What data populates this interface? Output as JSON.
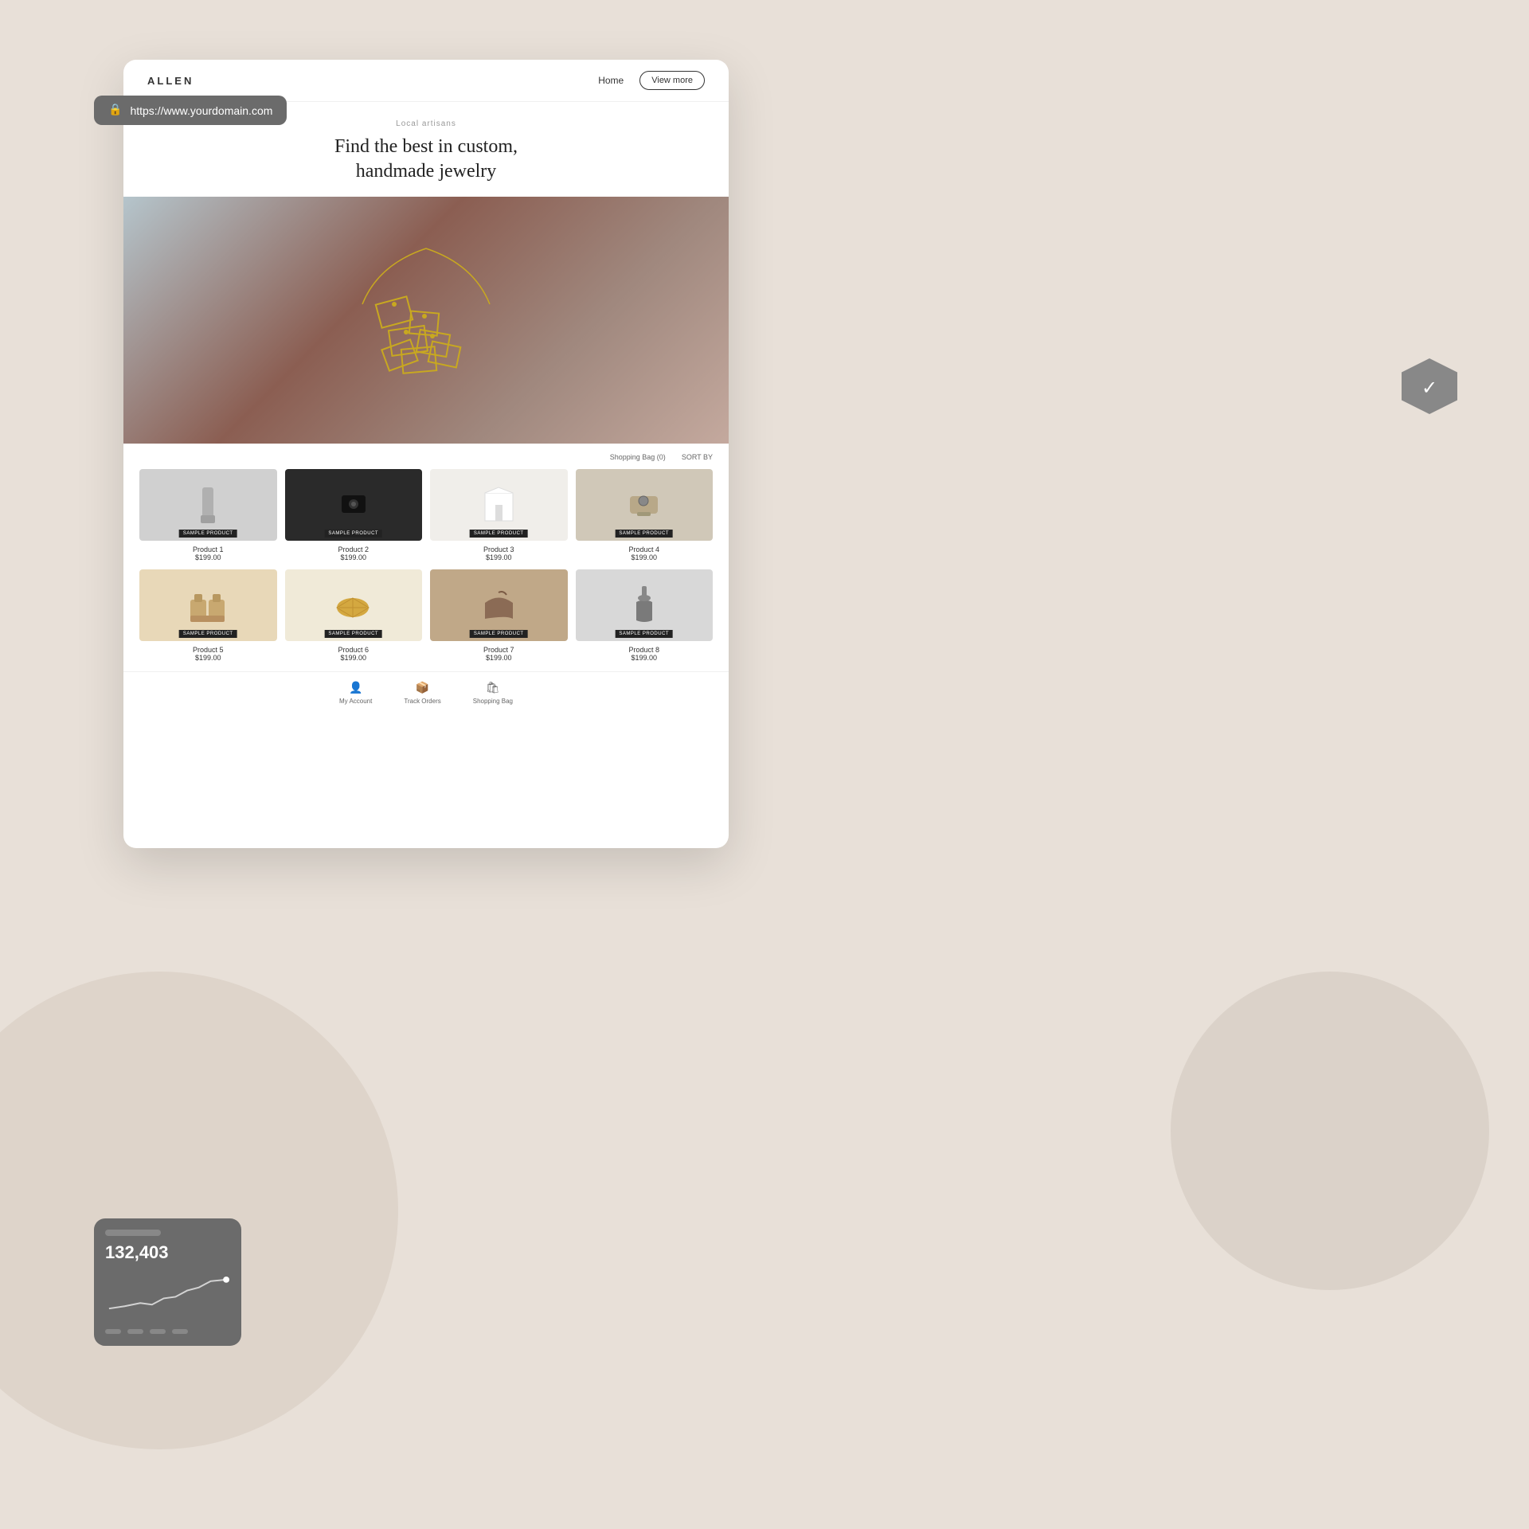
{
  "background": {
    "color": "#e8e0d8"
  },
  "url_bar": {
    "url": "https://www.yourdomain.com",
    "lock_icon": "🔒"
  },
  "site": {
    "logo": "ALLEN",
    "nav": {
      "home_label": "Home",
      "view_more_label": "View more"
    },
    "hero": {
      "subtitle": "Local artisans",
      "title_line1": "Find the best in custom,",
      "title_line2": "handmade jewelry"
    },
    "shopping_bag_label": "Shopping Bag (0)",
    "sort_label": "SORT BY",
    "products": [
      {
        "id": 1,
        "name": "Product 1",
        "price": "$199.00",
        "label": "SAMPLE PRODUCT",
        "color": "silver"
      },
      {
        "id": 2,
        "name": "Product 2",
        "price": "$199.00",
        "label": "SAMPLE PRODUCT",
        "color": "dark"
      },
      {
        "id": 3,
        "name": "Product 3",
        "price": "$199.00",
        "label": "SAMPLE PRODUCT",
        "color": "light"
      },
      {
        "id": 4,
        "name": "Product 4",
        "price": "$199.00",
        "label": "SAMPLE PRODUCT",
        "color": "tan"
      },
      {
        "id": 5,
        "name": "Product 5",
        "price": "$199.00",
        "label": "SAMPLE PRODUCT",
        "color": "cream"
      },
      {
        "id": 6,
        "name": "Product 6",
        "price": "$199.00",
        "label": "SAMPLE PRODUCT",
        "color": "gold"
      },
      {
        "id": 7,
        "name": "Product 7",
        "price": "$199.00",
        "label": "SAMPLE PRODUCT",
        "color": "brown"
      },
      {
        "id": 8,
        "name": "Product 8",
        "price": "$199.00",
        "label": "SAMPLE PRODUCT",
        "color": "blue"
      }
    ],
    "bottom_nav": [
      {
        "label": "My Account",
        "icon": "👤"
      },
      {
        "label": "Track Orders",
        "icon": "📦"
      },
      {
        "label": "Shopping Bag",
        "icon": "🛍"
      }
    ]
  },
  "analytics": {
    "number": "132,403"
  },
  "security_badge": {
    "check": "✓"
  }
}
